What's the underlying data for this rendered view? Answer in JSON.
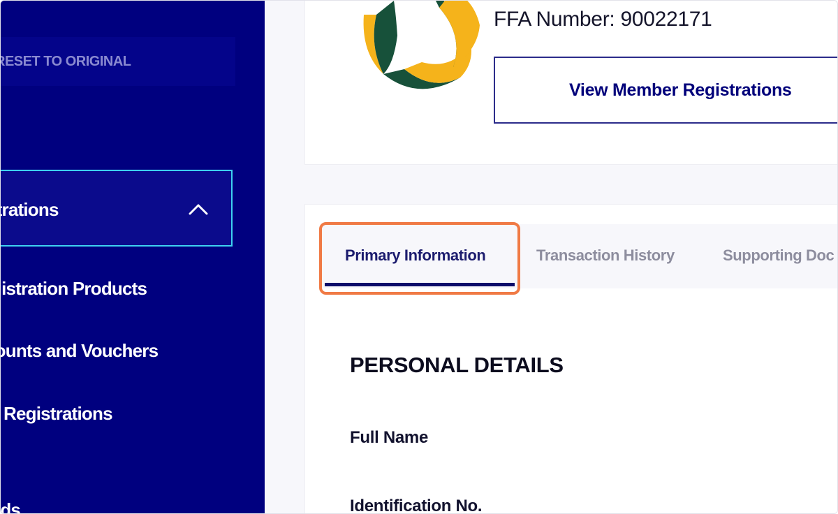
{
  "sidebar": {
    "reset_label": "RESET TO ORIGINAL",
    "group_label": "strations",
    "items": [
      {
        "label": "gistration Products"
      },
      {
        "label": "counts and Vouchers"
      },
      {
        "label": "Registrations"
      },
      {
        "label": "rds"
      }
    ]
  },
  "header": {
    "ffa_number": "FFA Number: 90022171",
    "view_button_label": "View Member Registrations"
  },
  "tabs": [
    {
      "label": "Primary Information",
      "active": true
    },
    {
      "label": "Transaction History",
      "active": false
    },
    {
      "label": "Supporting Doc",
      "active": false
    }
  ],
  "main": {
    "section_title": "PERSONAL DETAILS",
    "fields": [
      {
        "label": "Full Name"
      },
      {
        "label": "Identification No."
      }
    ]
  },
  "colors": {
    "sidebar_bg": "#00007f",
    "active_outline": "#3ed1f0",
    "highlight_outline": "#f07a45",
    "logo_green": "#17513a",
    "logo_yellow": "#f5b31b"
  },
  "icons": {
    "group_chevron": "chevron-up-icon",
    "logo": "football-federation-logo"
  }
}
